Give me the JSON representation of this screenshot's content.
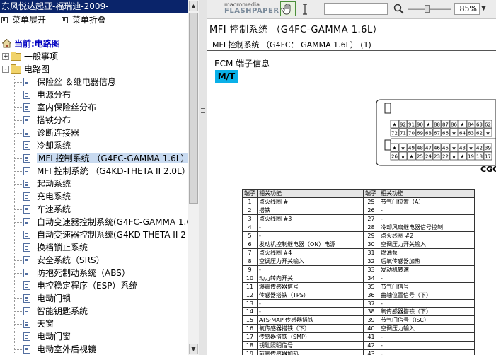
{
  "window": {
    "title": "东风悦达起亚-福瑞迪-2009-"
  },
  "left_menu": {
    "expand_label": "菜单展开",
    "collapse_label": "菜单折叠"
  },
  "tree": {
    "root_label": "当前:电路图",
    "nodes": [
      {
        "label": "一般事项",
        "toggle": "+"
      },
      {
        "label": "电路图",
        "toggle": "-"
      }
    ],
    "items": [
      "保险丝 ＆继电器信息",
      "电源分布",
      "室内保险丝分布",
      "搭铁分布",
      "诊断连接器",
      "冷却系统",
      "MFI 控制系统 （G4FC-GAMMA 1.6L）",
      "MFI 控制系统 （G4KD-THETA II 2.0L）",
      "起动系统",
      "充电系统",
      "车速系统",
      "自动变速器控制系统(G4FC-GAMMA 1.6",
      "自动变速器控制系统(G4KD-THETA II 2",
      "换档锁止系统",
      "安全系统（SRS）",
      "防抱死制动系统（ABS）",
      "电控稳定程序（ESP）系统",
      "电动门锁",
      "智能钥匙系统",
      "天窗",
      "电动门窗",
      "电动室外后视镜"
    ],
    "selected_index": 6
  },
  "flashpaper": {
    "logo_line1": "macromedia",
    "logo_line2": "FLASHPAPER",
    "page_input": "",
    "zoom_value": "85%",
    "zoom_level": 0.45
  },
  "document": {
    "heading": "MFI 控制系统 （G4FC-GAMMA 1.6L）",
    "subheading": "MFI 控制系统 （G4FC： GAMMA 1.6L） (1)",
    "ecm_label": "ECM 端子信息",
    "mt_badge": "M/T",
    "connector_label": "CGC",
    "connector_row1": [
      "★",
      "92",
      "91",
      "90",
      "★",
      "88",
      "87",
      "86",
      "★",
      "84",
      "63",
      "62"
    ],
    "connector_row2": [
      "72",
      "71",
      "70",
      "69",
      "68",
      "67",
      "66",
      "★",
      "64",
      "63",
      "62",
      "★"
    ],
    "connector_row3": [
      "★",
      "★",
      "49",
      "48",
      "47",
      "46",
      "45",
      "★",
      "43",
      "★",
      "42",
      "39"
    ],
    "connector_row4": [
      "26",
      "★",
      "★",
      "25",
      "24",
      "23",
      "22",
      "★",
      "★",
      "19",
      "18",
      "17"
    ],
    "table_headers": [
      "端子",
      "相关功能",
      "端子",
      "相关功能"
    ],
    "table_rows": [
      [
        "1",
        "点火线圈 #",
        "25",
        "节气门位置（A）"
      ],
      [
        "2",
        "搭铁",
        "26",
        "-"
      ],
      [
        "3",
        "点火线圈 #3",
        "27",
        "-"
      ],
      [
        "4",
        "-",
        "28",
        "冷却风扇继电器信号控制"
      ],
      [
        "5",
        "-",
        "29",
        "点火线圈 #2"
      ],
      [
        "6",
        "发动机控制继电器（ON）电源",
        "30",
        "空调压力开关输入"
      ],
      [
        "7",
        "点火线圈 #4",
        "31",
        "燃油泵"
      ],
      [
        "8",
        "空调压力开关输入",
        "32",
        "后氧传感器加热"
      ],
      [
        "9",
        "-",
        "33",
        "发动机转速"
      ],
      [
        "10",
        "动力转向开关",
        "34",
        "-"
      ],
      [
        "11",
        "爆震传感器信号",
        "35",
        "节气门信号"
      ],
      [
        "12",
        "传感器搭铁（TPS）",
        "36",
        "曲轴位置信号（下）"
      ],
      [
        "13",
        "-",
        "37",
        "-"
      ],
      [
        "14",
        "-",
        "38",
        "氧传感器搭铁（下）"
      ],
      [
        "15",
        "ATS·MAP 传感器搭铁",
        "39",
        "节气门信号（ISC）"
      ],
      [
        "16",
        "氧传感器搭铁（下）",
        "40",
        "空调压力输入"
      ],
      [
        "17",
        "传感器搭铁（SMP）",
        "41",
        "-"
      ],
      [
        "18",
        "钥匙照明信号",
        "42",
        "-"
      ],
      [
        "19",
        "前氧传感器加热",
        "43",
        "-"
      ]
    ]
  }
}
